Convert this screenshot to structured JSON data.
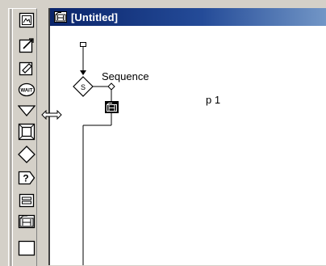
{
  "window": {
    "title": "[Untitled]"
  },
  "palette": {
    "tools": [
      {
        "icon": "display-icon"
      },
      {
        "icon": "animation-icon"
      },
      {
        "icon": "erase-icon"
      },
      {
        "icon": "wait-icon",
        "text": "WAIT"
      },
      {
        "icon": "navigate-icon"
      },
      {
        "icon": "framework-icon"
      },
      {
        "icon": "decision-icon"
      },
      {
        "icon": "interaction-icon",
        "text": "?"
      },
      {
        "icon": "calculation-icon",
        "text": "="
      },
      {
        "icon": "map-icon"
      }
    ]
  },
  "flowline": {
    "decision_label": "Sequence",
    "decision_symbol": "S",
    "path_label": "p 1"
  }
}
